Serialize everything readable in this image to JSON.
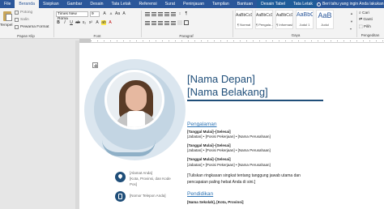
{
  "tabs": [
    "File",
    "Beranda",
    "Sisipkan",
    "Gambar",
    "Desain",
    "Tata Letak",
    "Referensi",
    "Surat",
    "Peninjauan",
    "Tampilan",
    "Bantuan",
    "Desain Tabel",
    "Tata Letak"
  ],
  "tell_me": "Beri tahu yang ingin Anda lakukan",
  "clipboard": {
    "paste": "Tempel",
    "cut": "Potong",
    "copy": "Salin",
    "format_painter": "Pewarna Format",
    "group_label": "Papan Klip"
  },
  "font": {
    "family": "Times New Roma",
    "size": "9",
    "group_label": "Font"
  },
  "paragraph": {
    "group_label": "Paragraf"
  },
  "styles": {
    "group_label": "Gaya",
    "items": [
      {
        "sample": "AaBbCcDc",
        "name": "¶ Normal"
      },
      {
        "sample": "AaBbCcDc",
        "name": "¶ Pengala..."
      },
      {
        "sample": "AaBbCcDc",
        "name": "¶ Informasi"
      },
      {
        "sample": "AaBbC",
        "name": "Judul 1"
      },
      {
        "sample": "AaB",
        "name": "Judul"
      }
    ]
  },
  "editing": {
    "find": "Cari",
    "replace": "Ganti",
    "select": "Pilih",
    "group_label": "Pengeditan"
  },
  "document": {
    "first_name": "[Nama Depan]",
    "last_name": "[Nama Belakang]",
    "experience_heading": "Pengalaman",
    "entries": [
      {
        "dates": "[Tanggal Mulai]–[Selesai]",
        "role": "[Jabatan] • [Posisi Pekerjaan] • [Nama Perusahaan]"
      },
      {
        "dates": "[Tanggal Mulai]–[Selesai]",
        "role": "[Jabatan] • [Posisi Pekerjaan] • [Nama Perusahaan]"
      },
      {
        "dates": "[Tanggal Mulai]–[Selesai]",
        "role": "[Jabatan] • [Posisi Pekerjaan] • [Nama Perusahaan]"
      }
    ],
    "summary_line1": "[Tuliskan ringkasan singkat tentang tanggung jawab utama dan",
    "summary_line2": "pencapaian paling hebat Anda di sini.]",
    "education_heading": "Pendidikan",
    "school": "[Nama Sekolah], [Kota, Provinsi]",
    "address_line1": "[Alamat Anda]",
    "address_line2": "[Kota, Provinsi, dan Kode",
    "address_line3": "Pos]",
    "phone": "[Nomor Telepon Anda]"
  },
  "colors": {
    "ribbon_blue": "#2b579a",
    "heading_navy": "#1f4e79",
    "section_blue": "#2e74b5"
  }
}
